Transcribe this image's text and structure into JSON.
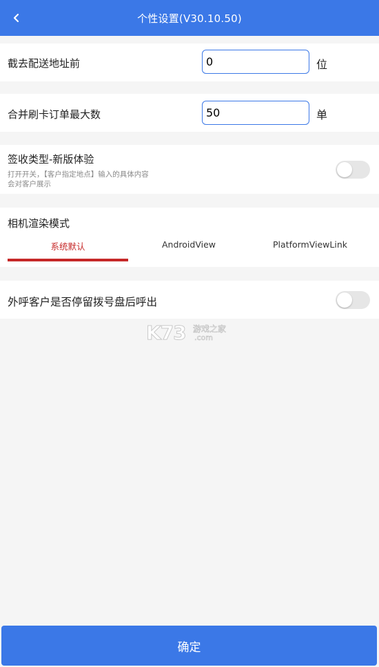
{
  "header": {
    "title": "个性设置(V30.10.50)",
    "back_icon": "chevron-left-icon"
  },
  "settings": {
    "truncate_address": {
      "label": "截去配送地址前",
      "value": "0",
      "unit": "位"
    },
    "merge_max": {
      "label": "合并刷卡订单最大数",
      "value": "50",
      "unit": "单"
    },
    "sign_type": {
      "label": "签收类型-新版体验",
      "description": "打开开关，【客户指定地点】输入的具体内容会对客户展示",
      "enabled": false
    },
    "camera_mode": {
      "label": "相机渲染模式",
      "options": [
        "系统默认",
        "AndroidView",
        "PlatformViewLink"
      ],
      "selected": "系统默认"
    },
    "outbound_call": {
      "label": "外呼客户是否停留拨号盘后呼出",
      "enabled": false
    }
  },
  "footer": {
    "confirm_label": "确定"
  },
  "watermark": {
    "text_main": "K73",
    "text_cn": "游戏之家",
    "text_sub": ".com"
  },
  "colors": {
    "primary": "#3b78e7",
    "accent_red": "#c62828",
    "background": "#f5f5f5"
  }
}
